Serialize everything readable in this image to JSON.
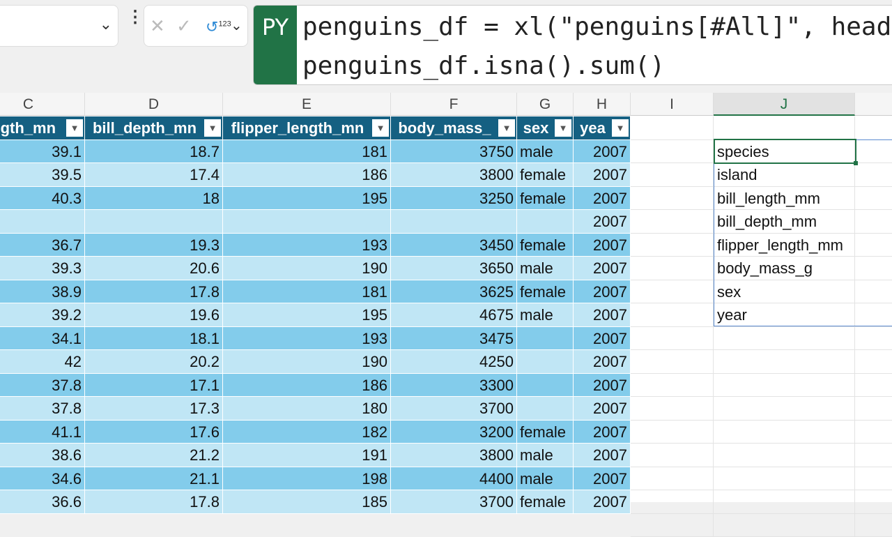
{
  "formula_bar": {
    "name_box_value": "",
    "python_badge": "PY",
    "code_lines": [
      "penguins_df = xl(\"penguins[#All]\", headers=True)",
      "penguins_df.isna().sum()"
    ],
    "superscript": "123"
  },
  "column_letters": [
    "C",
    "D",
    "E",
    "F",
    "G",
    "H",
    "I",
    "J"
  ],
  "table": {
    "headers": [
      "length_mm",
      "bill_depth_mm",
      "flipper_length_mm",
      "body_mass_g",
      "sex",
      "year"
    ],
    "header_visible": [
      "ength_mn",
      "bill_depth_mn",
      "flipper_length_mn",
      "body_mass_",
      "sex",
      "yea"
    ],
    "rows": [
      [
        "39.1",
        "18.7",
        "181",
        "3750",
        "male",
        "2007"
      ],
      [
        "39.5",
        "17.4",
        "186",
        "3800",
        "female",
        "2007"
      ],
      [
        "40.3",
        "18",
        "195",
        "3250",
        "female",
        "2007"
      ],
      [
        "",
        "",
        "",
        "",
        "",
        "2007"
      ],
      [
        "36.7",
        "19.3",
        "193",
        "3450",
        "female",
        "2007"
      ],
      [
        "39.3",
        "20.6",
        "190",
        "3650",
        "male",
        "2007"
      ],
      [
        "38.9",
        "17.8",
        "181",
        "3625",
        "female",
        "2007"
      ],
      [
        "39.2",
        "19.6",
        "195",
        "4675",
        "male",
        "2007"
      ],
      [
        "34.1",
        "18.1",
        "193",
        "3475",
        "",
        "2007"
      ],
      [
        "42",
        "20.2",
        "190",
        "4250",
        "",
        "2007"
      ],
      [
        "37.8",
        "17.1",
        "186",
        "3300",
        "",
        "2007"
      ],
      [
        "37.8",
        "17.3",
        "180",
        "3700",
        "",
        "2007"
      ],
      [
        "41.1",
        "17.6",
        "182",
        "3200",
        "female",
        "2007"
      ],
      [
        "38.6",
        "21.2",
        "191",
        "3800",
        "male",
        "2007"
      ],
      [
        "34.6",
        "21.1",
        "198",
        "4400",
        "male",
        "2007"
      ],
      [
        "36.6",
        "17.8",
        "185",
        "3700",
        "female",
        "2007"
      ]
    ]
  },
  "spill_output": [
    "species",
    "island",
    "bill_length_mm",
    "bill_depth_mm",
    "flipper_length_mm",
    "body_mass_g",
    "sex",
    "year"
  ],
  "colors": {
    "header": "#156082",
    "row_dark": "#83CCEB",
    "row_light": "#C0E6F5",
    "accent": "#217346"
  }
}
